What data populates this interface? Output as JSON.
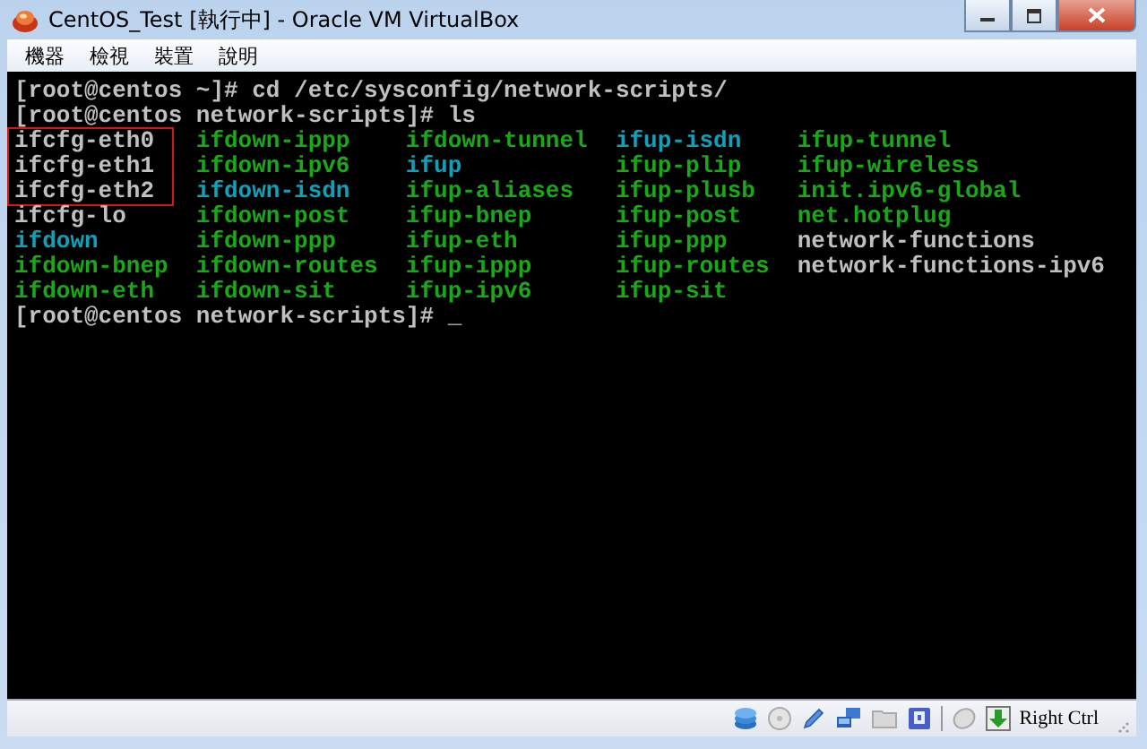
{
  "window": {
    "title": "CentOS_Test [執行中] - Oracle VM VirtualBox"
  },
  "menu": [
    "機器",
    "檢視",
    "裝置",
    "說明"
  ],
  "terminal": {
    "lines": [
      "[root@centos ~]# cd /etc/sysconfig/network-scripts/",
      "[root@centos network-scripts]# ls"
    ],
    "listing": [
      [
        {
          "name": "ifcfg-eth0",
          "color": "#c0c0c0",
          "highlighted": true
        },
        {
          "name": "ifdown-ippp",
          "color": "#18a818",
          "highlighted": false
        },
        {
          "name": "ifdown-tunnel",
          "color": "#18a818",
          "highlighted": false
        },
        {
          "name": "ifup-isdn",
          "color": "#10a0b8",
          "highlighted": false
        },
        {
          "name": "ifup-tunnel",
          "color": "#18a818",
          "highlighted": false
        }
      ],
      [
        {
          "name": "ifcfg-eth1",
          "color": "#c0c0c0",
          "highlighted": true
        },
        {
          "name": "ifdown-ipv6",
          "color": "#18a818",
          "highlighted": false
        },
        {
          "name": "ifup",
          "color": "#10a0b8",
          "highlighted": false
        },
        {
          "name": "ifup-plip",
          "color": "#18a818",
          "highlighted": false
        },
        {
          "name": "ifup-wireless",
          "color": "#18a818",
          "highlighted": false
        }
      ],
      [
        {
          "name": "ifcfg-eth2",
          "color": "#c0c0c0",
          "highlighted": true
        },
        {
          "name": "ifdown-isdn",
          "color": "#10a0b8",
          "highlighted": false
        },
        {
          "name": "ifup-aliases",
          "color": "#18a818",
          "highlighted": false
        },
        {
          "name": "ifup-plusb",
          "color": "#18a818",
          "highlighted": false
        },
        {
          "name": "init.ipv6-global",
          "color": "#18a818",
          "highlighted": false
        }
      ],
      [
        {
          "name": "ifcfg-lo",
          "color": "#c0c0c0",
          "highlighted": false
        },
        {
          "name": "ifdown-post",
          "color": "#18a818",
          "highlighted": false
        },
        {
          "name": "ifup-bnep",
          "color": "#18a818",
          "highlighted": false
        },
        {
          "name": "ifup-post",
          "color": "#18a818",
          "highlighted": false
        },
        {
          "name": "net.hotplug",
          "color": "#18a818",
          "highlighted": false
        }
      ],
      [
        {
          "name": "ifdown",
          "color": "#10a0b8",
          "highlighted": false
        },
        {
          "name": "ifdown-ppp",
          "color": "#18a818",
          "highlighted": false
        },
        {
          "name": "ifup-eth",
          "color": "#18a818",
          "highlighted": false
        },
        {
          "name": "ifup-ppp",
          "color": "#18a818",
          "highlighted": false
        },
        {
          "name": "network-functions",
          "color": "#c0c0c0",
          "highlighted": false
        }
      ],
      [
        {
          "name": "ifdown-bnep",
          "color": "#18a818",
          "highlighted": false
        },
        {
          "name": "ifdown-routes",
          "color": "#18a818",
          "highlighted": false
        },
        {
          "name": "ifup-ippp",
          "color": "#18a818",
          "highlighted": false
        },
        {
          "name": "ifup-routes",
          "color": "#18a818",
          "highlighted": false
        },
        {
          "name": "network-functions-ipv6",
          "color": "#c0c0c0",
          "highlighted": false
        }
      ],
      [
        {
          "name": "ifdown-eth",
          "color": "#18a818",
          "highlighted": false
        },
        {
          "name": "ifdown-sit",
          "color": "#18a818",
          "highlighted": false
        },
        {
          "name": "ifup-ipv6",
          "color": "#18a818",
          "highlighted": false
        },
        {
          "name": "ifup-sit",
          "color": "#18a818",
          "highlighted": false
        }
      ]
    ],
    "prompt": "[root@centos network-scripts]#",
    "cursor": "_"
  },
  "status_bar": {
    "host_key": "Right Ctrl"
  }
}
